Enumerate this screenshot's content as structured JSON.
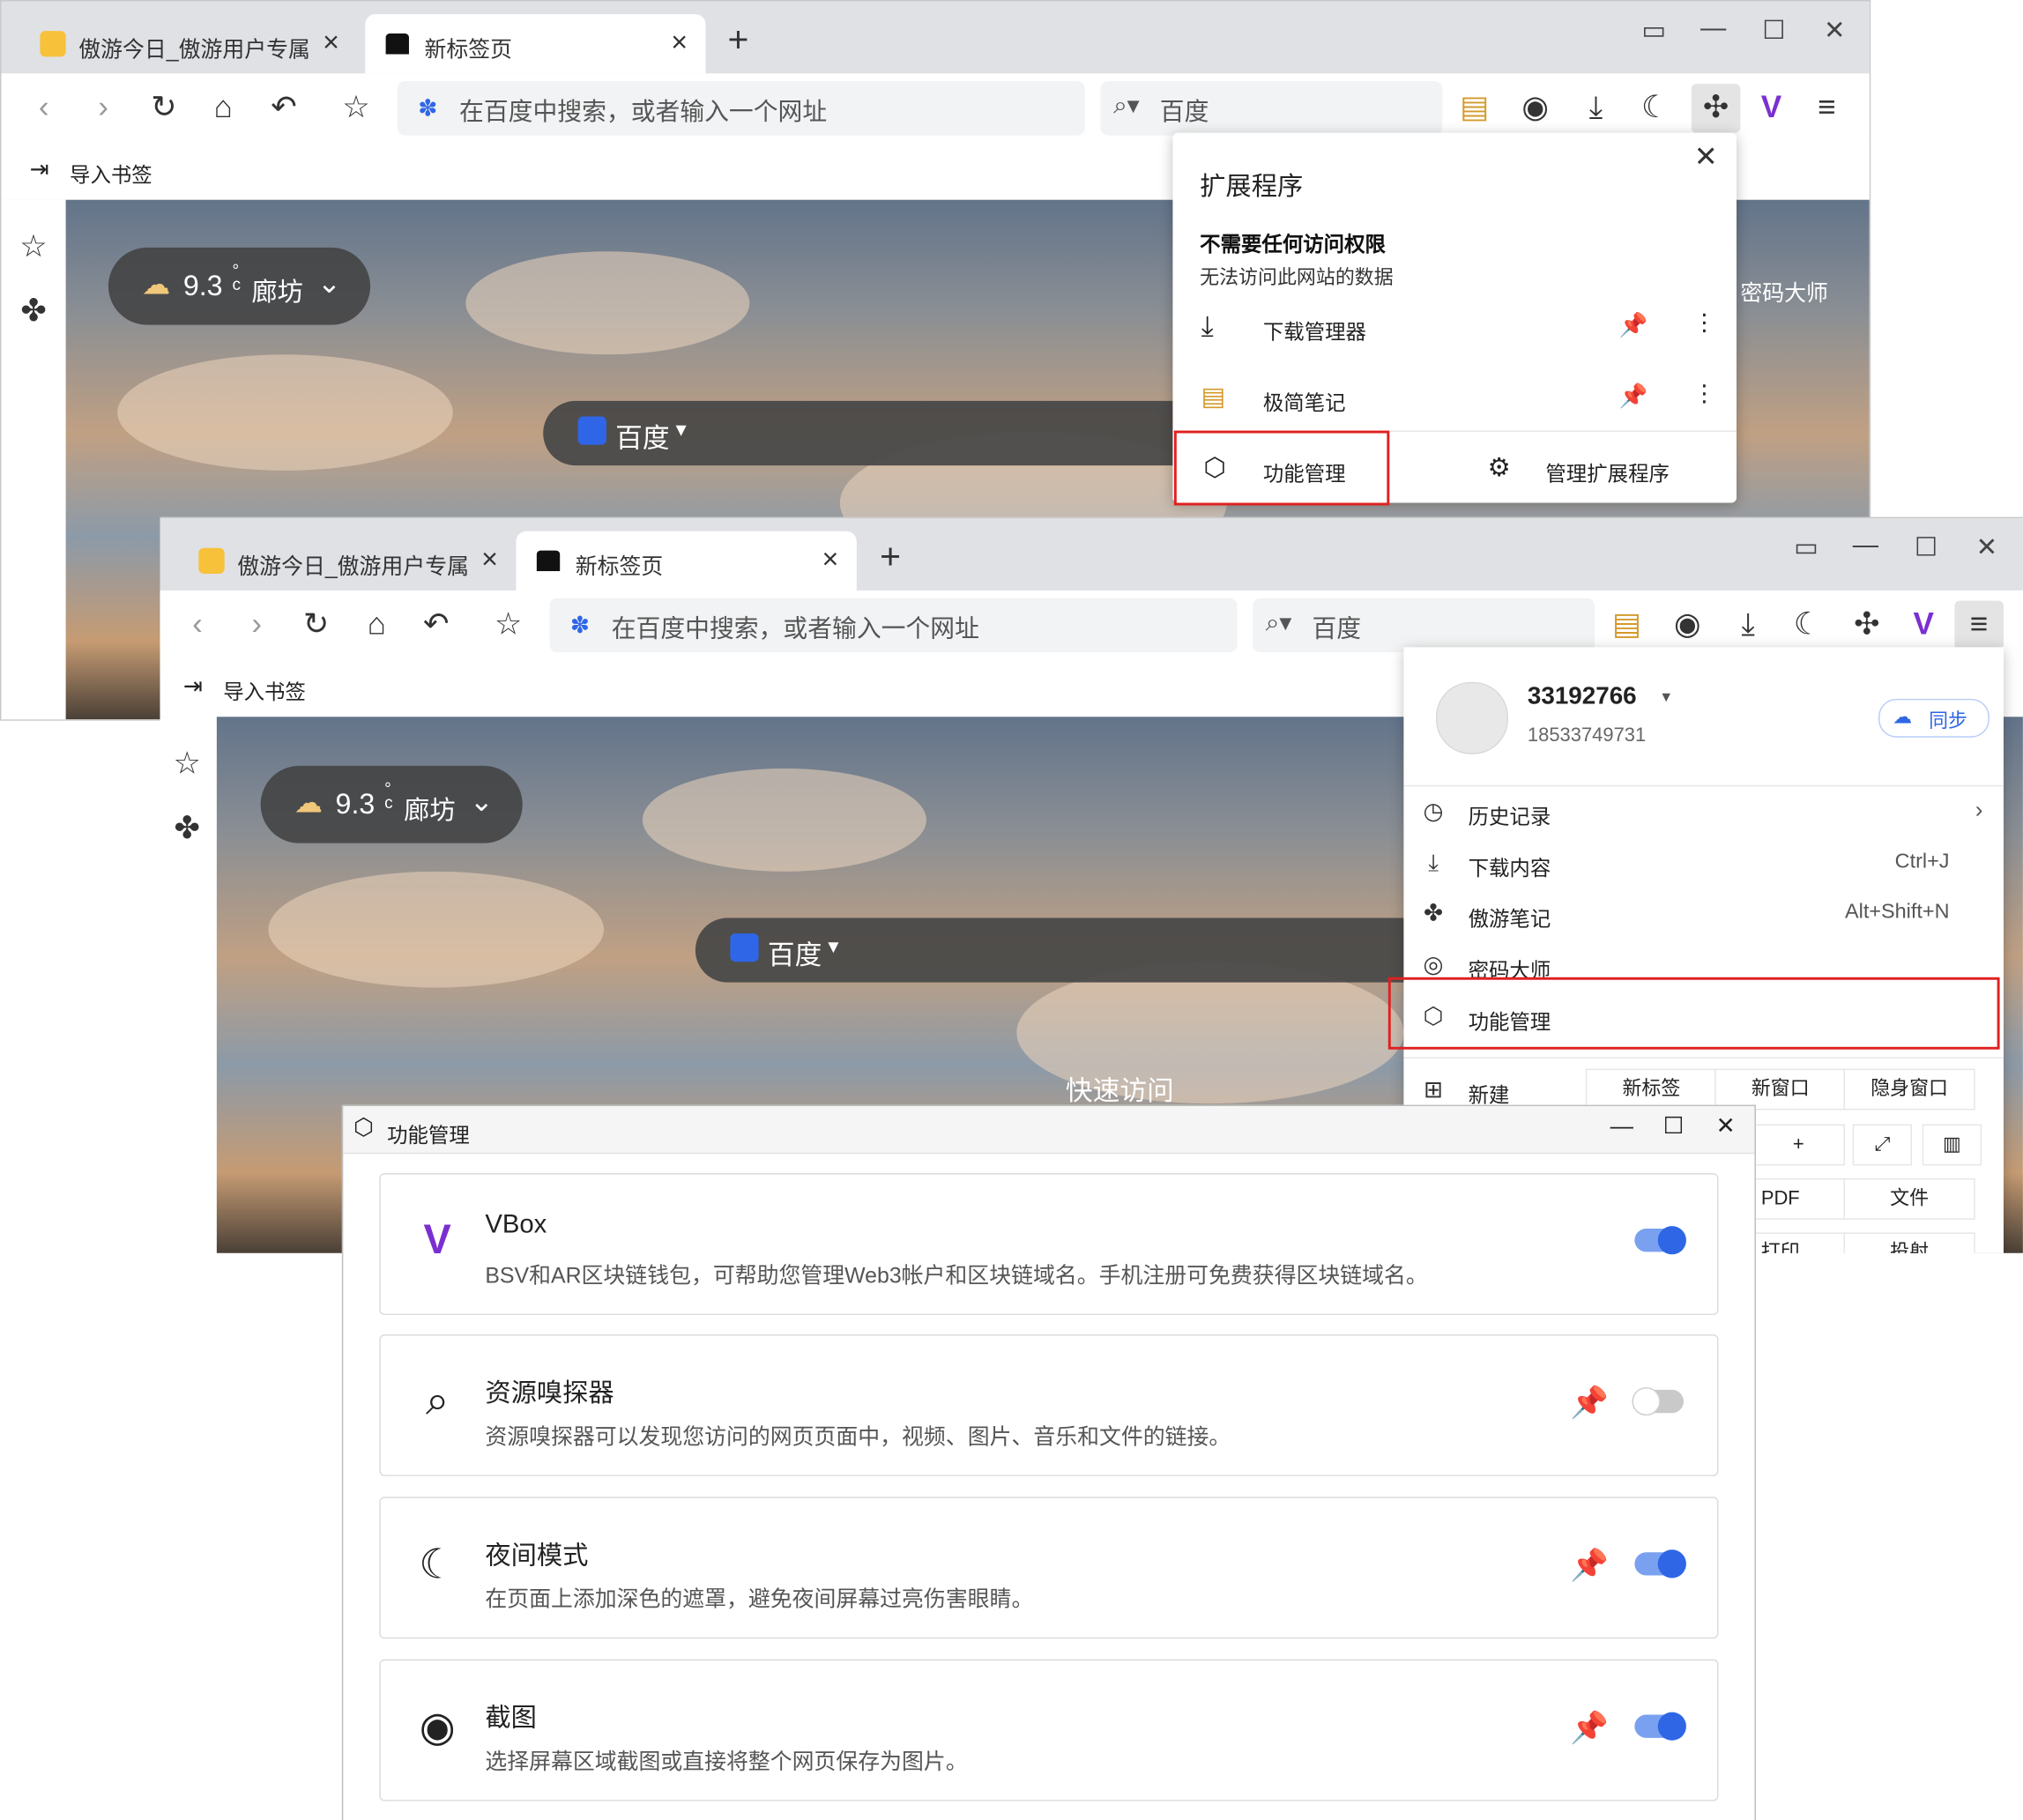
{
  "browser1": {
    "tabs": [
      {
        "label": "傲游今日_傲游用户专属"
      },
      {
        "label": "新标签页"
      }
    ],
    "address_placeholder": "在百度中搜索，或者输入一个网址",
    "search_engine": "百度",
    "bookmark_import": "导入书签",
    "weather": {
      "temp": "9.3",
      "unit": "°c",
      "city": "廊坊"
    },
    "engine_label": "百度",
    "password_master": "密码大师",
    "extensions_panel": {
      "title": "扩展程序",
      "section_title": "不需要任何访问权限",
      "section_sub": "无法访问此网站的数据",
      "items": [
        {
          "label": "下载管理器"
        },
        {
          "label": "极简笔记"
        }
      ],
      "footer_left": "功能管理",
      "footer_right": "管理扩展程序"
    }
  },
  "browser2": {
    "tabs": [
      {
        "label": "傲游今日_傲游用户专属"
      },
      {
        "label": "新标签页"
      }
    ],
    "address_placeholder": "在百度中搜索，或者输入一个网址",
    "search_engine": "百度",
    "bookmark_import": "导入书签",
    "weather": {
      "temp": "9.3",
      "unit": "°c",
      "city": "廊坊"
    },
    "engine_label": "百度",
    "quick_access": "快速访问",
    "menu": {
      "user_id": "33192766",
      "phone": "18533749731",
      "sync": "同步",
      "items": [
        {
          "label": "历史记录",
          "shortcut": "",
          "icon": "history-icon"
        },
        {
          "label": "下载内容",
          "shortcut": "Ctrl+J",
          "icon": "download-icon"
        },
        {
          "label": "傲游笔记",
          "shortcut": "Alt+Shift+N",
          "icon": "note-icon"
        },
        {
          "label": "密码大师",
          "shortcut": "",
          "icon": "fingerprint-icon"
        },
        {
          "label": "功能管理",
          "shortcut": "",
          "icon": "cube-icon"
        }
      ],
      "new_label": "新建",
      "new_buttons": [
        "新标签",
        "新窗口",
        "隐身窗口"
      ],
      "zoom_plus": "+",
      "row3": [
        "PDF",
        "文件"
      ],
      "row4": [
        "打印",
        "投射"
      ]
    }
  },
  "feature_dialog": {
    "title": "功能管理",
    "cards": [
      {
        "title": "VBox",
        "desc": "BSV和AR区块链钱包，可帮助您管理Web3帐户和区块链域名。手机注册可免费获得区块链域名。",
        "enabled": true,
        "pinned": false,
        "icon": "vbox-icon"
      },
      {
        "title": "资源嗅探器",
        "desc": "资源嗅探器可以发现您访问的网页页面中，视频、图片、音乐和文件的链接。",
        "enabled": false,
        "pinned": true,
        "icon": "sniffer-icon"
      },
      {
        "title": "夜间模式",
        "desc": "在页面上添加深色的遮罩，避免夜间屏幕过亮伤害眼睛。",
        "enabled": true,
        "pinned": true,
        "icon": "moon-icon"
      },
      {
        "title": "截图",
        "desc": "选择屏幕区域截图或直接将整个网页保存为图片。",
        "enabled": true,
        "pinned": true,
        "icon": "camera-icon"
      }
    ]
  },
  "colors": {
    "accent": "#2e66e6",
    "highlight": "#e02020",
    "brand_purple": "#7b2fd0"
  }
}
